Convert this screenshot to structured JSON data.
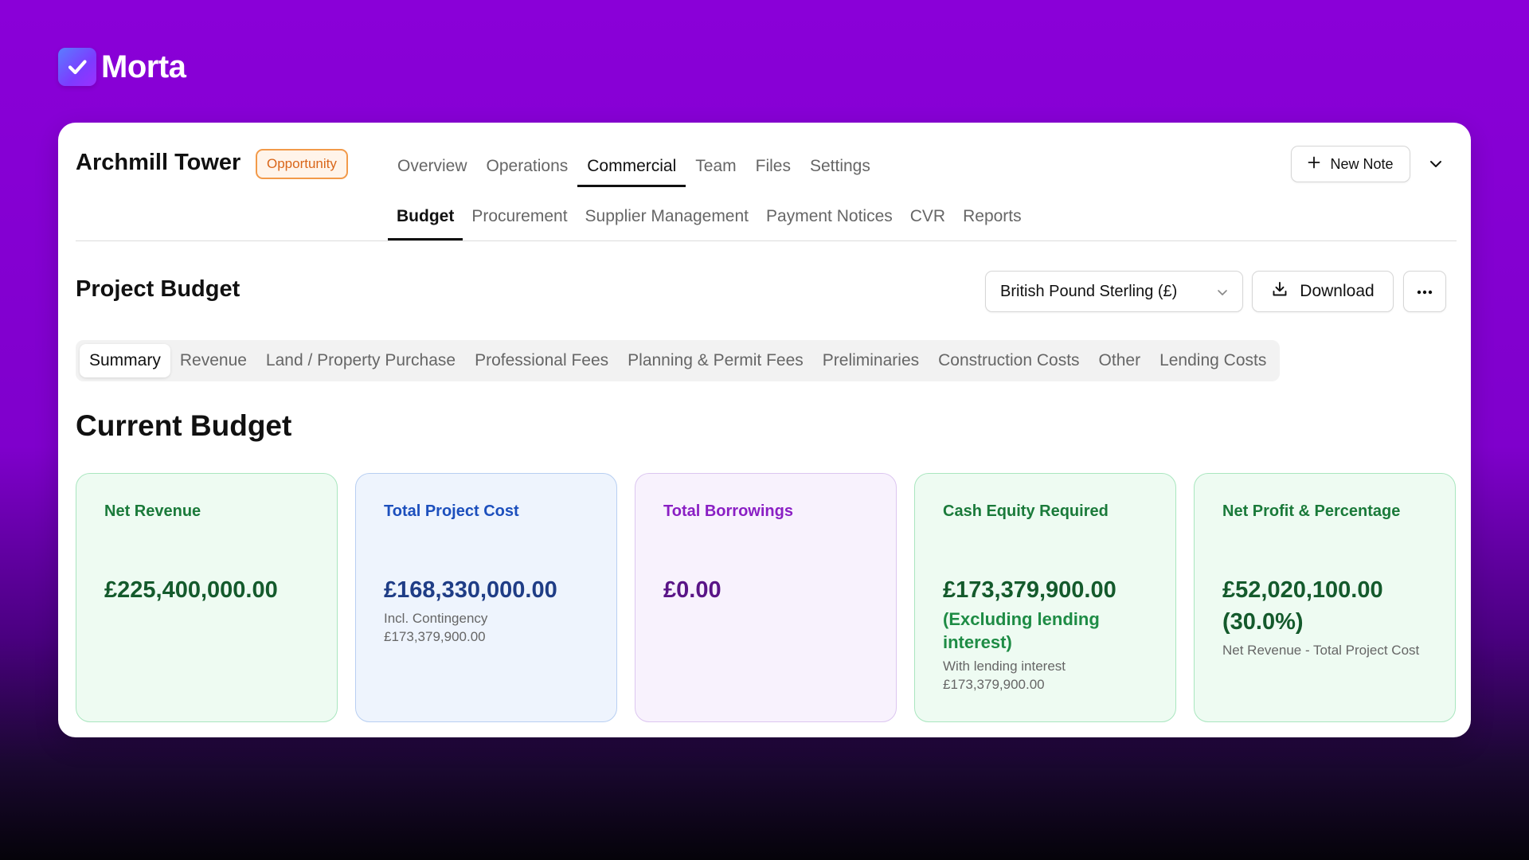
{
  "brand": {
    "name": "Morta",
    "icon": "check-icon"
  },
  "project": {
    "title": "Archmill Tower",
    "badge": "Opportunity"
  },
  "top_tabs": [
    {
      "label": "Overview",
      "active": false
    },
    {
      "label": "Operations",
      "active": false
    },
    {
      "label": "Commercial",
      "active": true
    },
    {
      "label": "Team",
      "active": false
    },
    {
      "label": "Files",
      "active": false
    },
    {
      "label": "Settings",
      "active": false
    }
  ],
  "sub_tabs": [
    {
      "label": "Budget",
      "active": true
    },
    {
      "label": "Procurement",
      "active": false
    },
    {
      "label": "Supplier Management",
      "active": false
    },
    {
      "label": "Payment Notices",
      "active": false
    },
    {
      "label": "CVR",
      "active": false
    },
    {
      "label": "Reports",
      "active": false
    }
  ],
  "header_actions": {
    "new_note": "New Note"
  },
  "budget": {
    "title": "Project Budget",
    "currency": "British Pound Sterling (£)",
    "download": "Download"
  },
  "segments": [
    {
      "label": "Summary",
      "active": true
    },
    {
      "label": "Revenue",
      "active": false
    },
    {
      "label": "Land / Property Purchase",
      "active": false
    },
    {
      "label": "Professional Fees",
      "active": false
    },
    {
      "label": "Planning & Permit Fees",
      "active": false
    },
    {
      "label": "Preliminaries",
      "active": false
    },
    {
      "label": "Construction Costs",
      "active": false
    },
    {
      "label": "Other",
      "active": false
    },
    {
      "label": "Lending Costs",
      "active": false
    }
  ],
  "current_budget": {
    "title": "Current Budget",
    "tiles": [
      {
        "label": "Net Revenue",
        "value": "£225,400,000.00"
      },
      {
        "label": "Total Project Cost",
        "value": "£168,330,000.00",
        "note": "Incl. Contingency £173,379,900.00"
      },
      {
        "label": "Total Borrowings",
        "value": "£0.00"
      },
      {
        "label": "Cash Equity Required",
        "value": "£173,379,900.00",
        "value2": "(Excluding lending interest)",
        "note": "With lending interest £173,379,900.00"
      },
      {
        "label": "Net Profit & Percentage",
        "value": "£52,020,100.00 (30.0%)",
        "note": "Net Revenue - Total Project Cost"
      }
    ]
  },
  "colors": {
    "background": "#8a00d8",
    "green": "#145a2c",
    "blue": "#1f3d86",
    "purple": "#5a1587",
    "badge": "#d9661a"
  }
}
